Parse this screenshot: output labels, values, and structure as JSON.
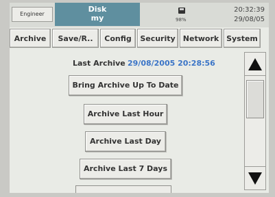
{
  "status": {
    "user": "Engineer",
    "disk_title": "Disk",
    "disk_subtitle": "my",
    "disk_percent": "98%",
    "time": "20:32:39",
    "date": "29/08/05"
  },
  "tabs": [
    {
      "label": "Archive"
    },
    {
      "label": "Save/R.."
    },
    {
      "label": "Config"
    },
    {
      "label": "Security"
    },
    {
      "label": "Network"
    },
    {
      "label": "System"
    }
  ],
  "archive": {
    "last_archive_label": "Last Archive",
    "last_archive_value": "29/08/2005 20:28:56",
    "buttons": [
      {
        "label": "Bring Archive Up To Date"
      },
      {
        "label": "Archive Last Hour"
      },
      {
        "label": "Archive Last Day"
      },
      {
        "label": "Archive Last 7 Days"
      }
    ]
  },
  "icons": {
    "disk": "floppy-disk-icon",
    "scroll_up": "triangle-up-icon",
    "scroll_down": "triangle-down-icon"
  }
}
